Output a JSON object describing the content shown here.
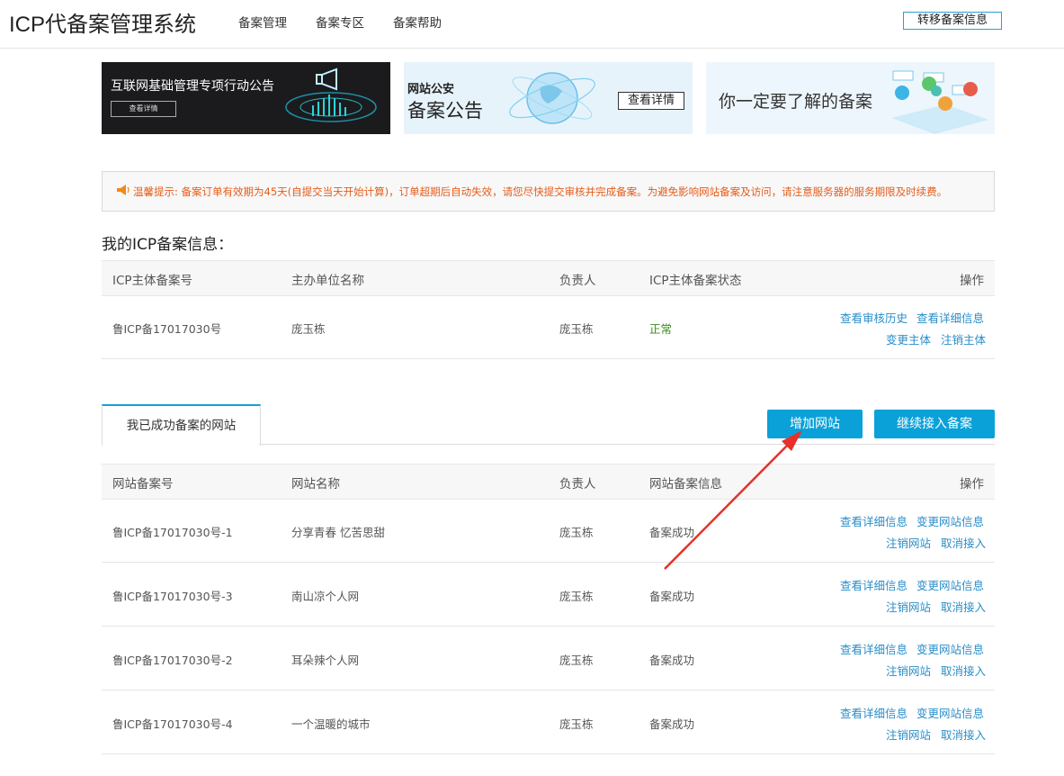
{
  "header": {
    "title": "ICP代备案管理系统",
    "nav": [
      "备案管理",
      "备案专区",
      "备案帮助"
    ],
    "transfer_button": "转移备案信息"
  },
  "banners": {
    "b1": {
      "title": "互联网基础管理专项行动公告",
      "button": "查看详情"
    },
    "b2": {
      "line1": "网站公安",
      "line2": "备案公告",
      "button": "查看详情"
    },
    "b3": {
      "title": "你一定要了解的备案"
    }
  },
  "notice": {
    "text": "温馨提示: 备案订单有效期为45天(自提交当天开始计算)，订单超期后自动失效，请您尽快提交审核并完成备案。为避免影响网站备案及访问，请注意服务器的服务期限及时续费。"
  },
  "icp_section": {
    "title": "我的ICP备案信息：",
    "headers": [
      "ICP主体备案号",
      "主办单位名称",
      "负责人",
      "ICP主体备案状态",
      "操作"
    ],
    "row": {
      "number": "鲁ICP备17017030号",
      "org": "庞玉栋",
      "owner": "庞玉栋",
      "status": "正常",
      "actions": [
        "查看审核历史",
        "查看详细信息",
        "变更主体",
        "注销主体"
      ]
    }
  },
  "sites_section": {
    "tab_label": "我已成功备案的网站",
    "add_button": "增加网站",
    "continue_button": "继续接入备案",
    "headers": [
      "网站备案号",
      "网站名称",
      "负责人",
      "网站备案信息",
      "操作"
    ],
    "rows": [
      {
        "number": "鲁ICP备17017030号-1",
        "name": "分享青春 忆苦思甜",
        "owner": "庞玉栋",
        "status": "备案成功"
      },
      {
        "number": "鲁ICP备17017030号-3",
        "name": "南山凉个人网",
        "owner": "庞玉栋",
        "status": "备案成功"
      },
      {
        "number": "鲁ICP备17017030号-2",
        "name": "耳朵辣个人网",
        "owner": "庞玉栋",
        "status": "备案成功"
      },
      {
        "number": "鲁ICP备17017030号-4",
        "name": "一个温暖的城市",
        "owner": "庞玉栋",
        "status": "备案成功"
      }
    ],
    "row_actions": [
      "查看详细信息",
      "变更网站信息",
      "注销网站",
      "取消接入"
    ]
  },
  "colors": {
    "accent": "#0aa1d9",
    "link": "#2a8ec8",
    "warning": "#e65c1a",
    "annotation": "#e8302a"
  }
}
